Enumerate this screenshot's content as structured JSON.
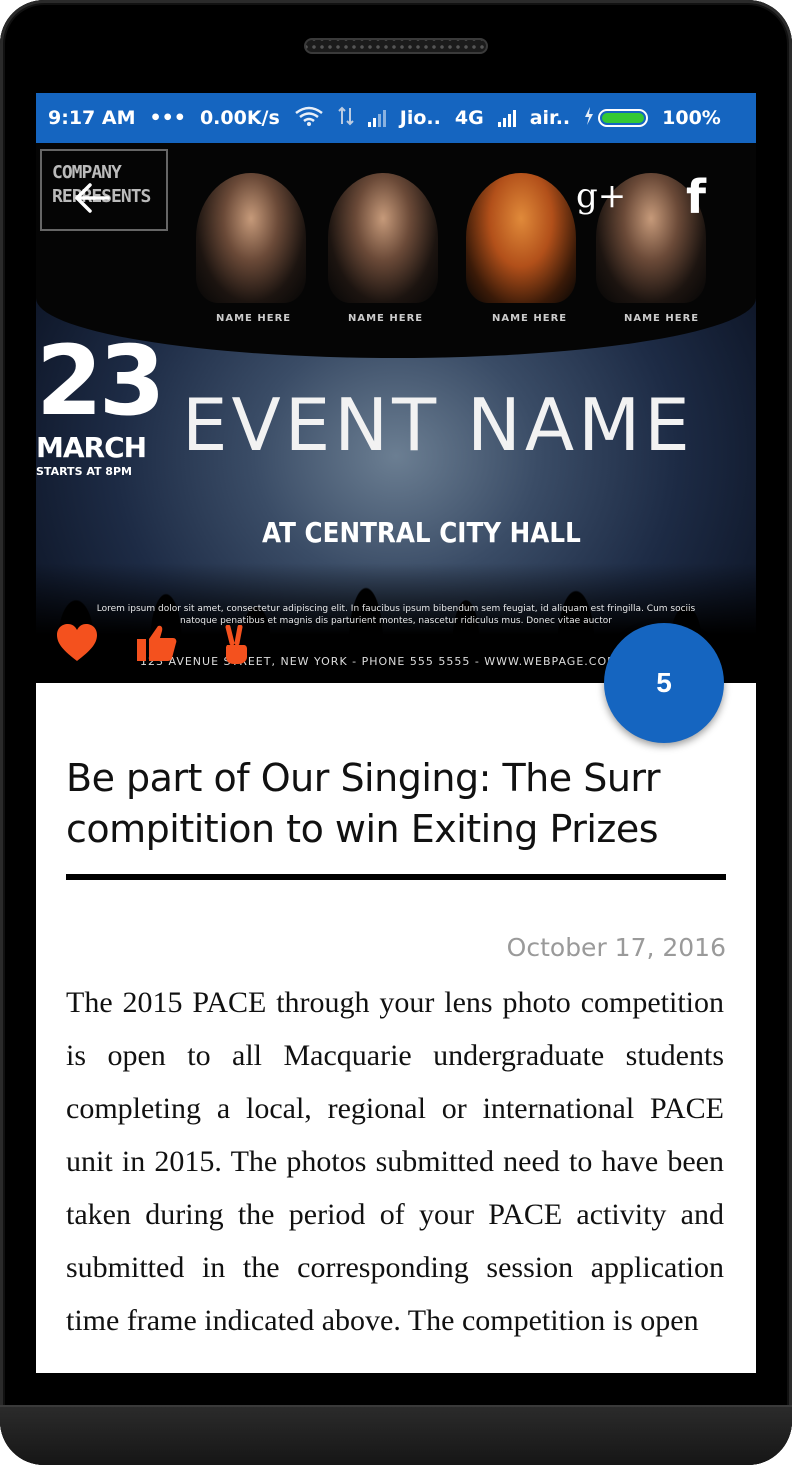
{
  "status_bar": {
    "time": "9:17 AM",
    "dots": "•••",
    "net_speed": "0.00K/s",
    "carrier1": "Jio..",
    "network": "4G",
    "carrier2": "air..",
    "battery": "100%"
  },
  "poster": {
    "company": "COMPANY REPRESENTS",
    "performer_label": "NAME HERE",
    "date_day": "23",
    "date_month": "MARCH",
    "date_time": "STARTS AT 8PM",
    "event_name": "EVENT NAME",
    "venue": "AT CENTRAL CITY HALL",
    "lorem_1": "Lorem ipsum dolor sit amet, consectetur adipiscing elit. In faucibus ipsum bibendum sem feugiat, id aliquam est fringilla. Cum sociis",
    "lorem_2": "natoque penatibus et magnis dis parturient montes, nascetur ridiculus mus. Donec vitae auctor",
    "address": "123 AVENUE STREET, NEW YORK - PHONE 555 5555 - WWW.WEBPAGE.COM"
  },
  "icons": {
    "back": "arrow-left-icon",
    "google_plus": "g+",
    "facebook": "f",
    "heart": "heart-icon",
    "like": "thumbs-up-icon",
    "peace": "peace-hand-icon"
  },
  "fab": {
    "count": "5"
  },
  "article": {
    "title": "Be part of Our Singing: The Surr compitition to win Exiting Prizes",
    "date": "October 17, 2016",
    "body": "The 2015 PACE through your lens photo competition is open to all Macquarie undergraduate students completing a local, regional or international PACE unit in 2015. The photos submitted need to have been taken during the period of your PACE activity and submitted in the corresponding session application time frame indicated above. The competition is open"
  },
  "colors": {
    "status_bar": "#1565c0",
    "fab": "#1565c0",
    "reaction": "#f4511e",
    "date_text": "#9a9a9a"
  }
}
